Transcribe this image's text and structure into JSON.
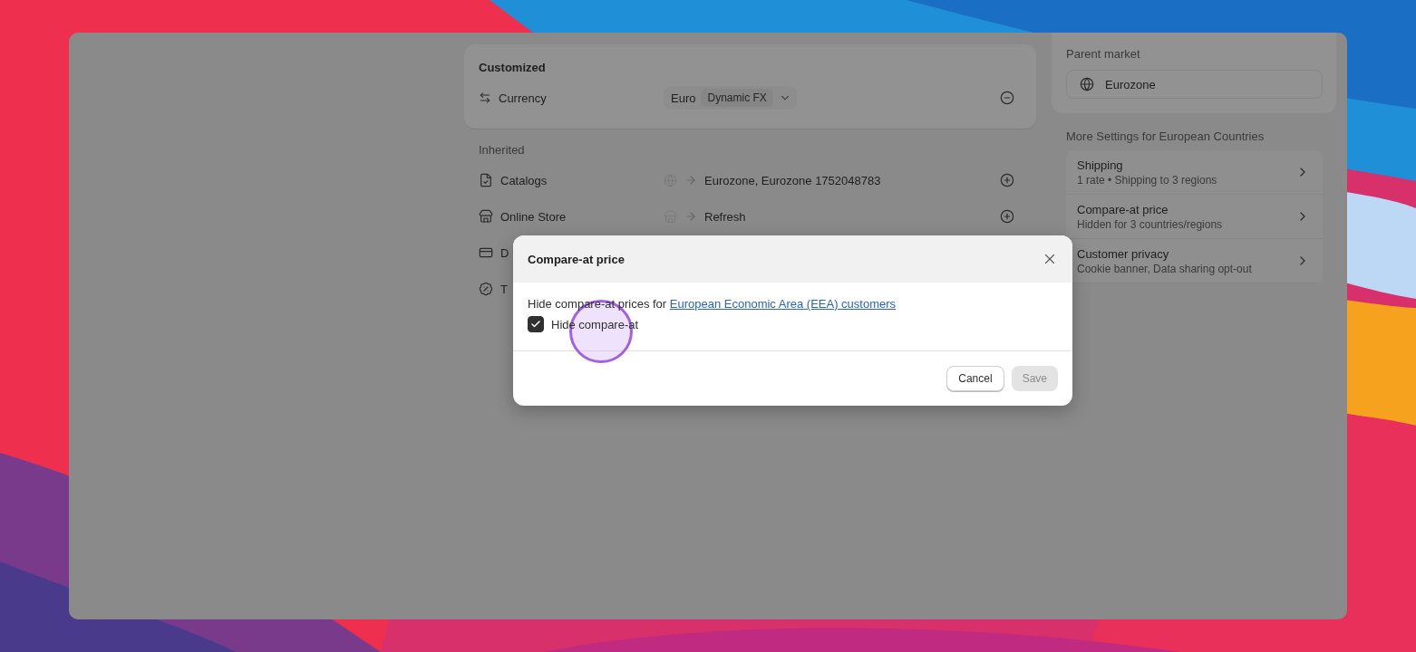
{
  "customized": {
    "title": "Customized",
    "rows": [
      {
        "label": "Currency",
        "value": "Euro",
        "badge": "Dynamic FX"
      }
    ]
  },
  "inherited": {
    "title": "Inherited",
    "rows": [
      {
        "label": "Catalogs",
        "value": "Eurozone, Eurozone 1752048783"
      },
      {
        "label": "Online Store",
        "value": "Refresh"
      },
      {
        "label": "D"
      },
      {
        "label": "T"
      }
    ]
  },
  "parent_market": {
    "title": "Parent market",
    "value": "Eurozone"
  },
  "more_settings": {
    "title": "More Settings for European Countries",
    "items": [
      {
        "title": "Shipping",
        "subtitle": "1 rate • Shipping to 3 regions"
      },
      {
        "title": "Compare-at price",
        "subtitle": "Hidden for 3 countries/regions"
      },
      {
        "title": "Customer privacy",
        "subtitle": "Cookie banner, Data sharing opt-out"
      }
    ]
  },
  "dialog": {
    "title": "Compare-at price",
    "text": "Hide compare-at prices for",
    "link": "European Economic Area (EEA) customers",
    "checkbox": {
      "label": "Hide compare-at",
      "checked": true
    },
    "buttons": [
      {
        "label": "Cancel",
        "disabled": false
      },
      {
        "label": "Save",
        "disabled": true
      }
    ]
  }
}
